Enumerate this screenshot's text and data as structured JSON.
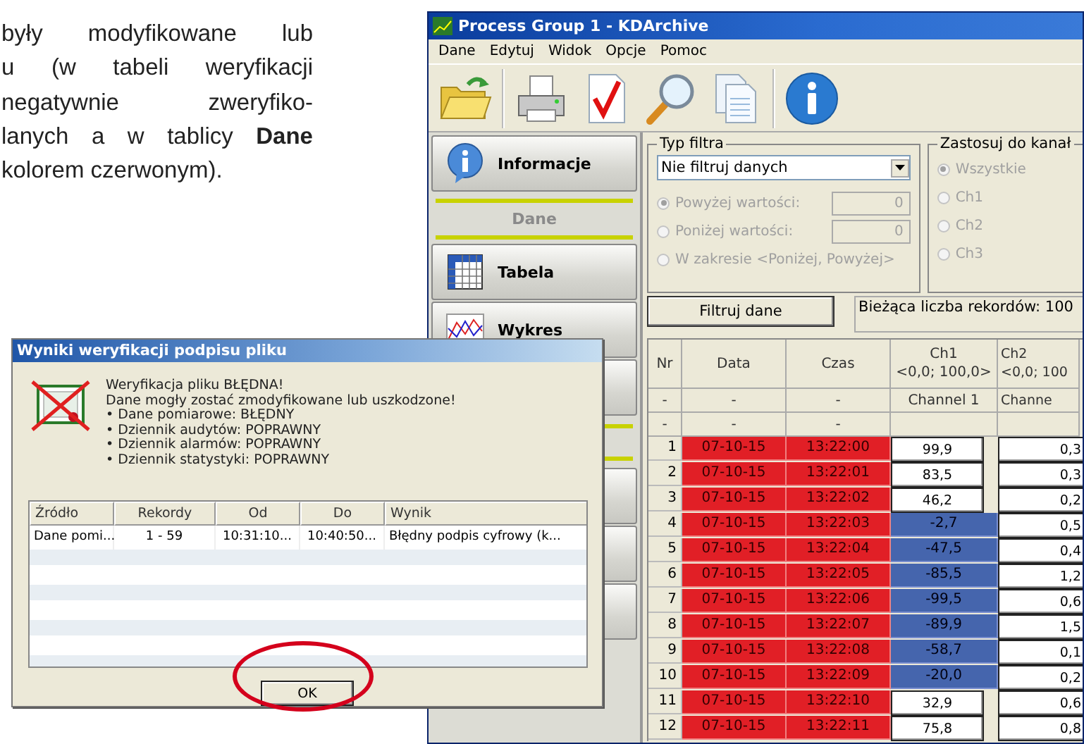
{
  "paragraph": [
    "były modyfikowane lub",
    "u (w tabeli weryfikacji",
    "negatywnie zweryfiko-",
    "lanych a w tablicy **Dane**",
    "kolorem czerwonym)."
  ],
  "window": {
    "title": "Process Group 1 - KDArchive"
  },
  "menu": [
    "Dane",
    "Edytuj",
    "Widok",
    "Opcje",
    "Pomoc"
  ],
  "sidebar": {
    "items": [
      {
        "kind": "info-button",
        "label": "Informacje"
      },
      {
        "kind": "section",
        "label": "Dane"
      },
      {
        "kind": "table-button",
        "label": "Tabela"
      },
      {
        "kind": "chart-button",
        "label": "Wykres"
      },
      {
        "kind": "button"
      },
      {
        "kind": "section"
      },
      {
        "kind": "button"
      },
      {
        "kind": "button"
      },
      {
        "kind": "button"
      }
    ]
  },
  "filter": {
    "legend": "Typ filtra",
    "select_value": "Nie filtruj danych",
    "options": [
      {
        "label": "Powyżej wartości:",
        "selected": true,
        "disabled": true,
        "value": "0"
      },
      {
        "label": "Poniżej wartości:",
        "selected": false,
        "disabled": true,
        "value": "0"
      },
      {
        "label": "W zakresie <Poniżej, Powyżej>",
        "selected": false,
        "disabled": true
      }
    ]
  },
  "channels_group": {
    "legend": "Zastosuj do kanał",
    "options": [
      {
        "label": "Wszystkie",
        "selected": true,
        "disabled": true
      },
      {
        "label": "Ch1",
        "selected": false,
        "disabled": true
      },
      {
        "label": "Ch2",
        "selected": false,
        "disabled": true
      },
      {
        "label": "Ch3",
        "selected": false,
        "disabled": true
      }
    ]
  },
  "filter_button": "Filtruj dane",
  "record_count": "Bieżąca liczba rekordów: 100",
  "table": {
    "columns": [
      [
        "Nr"
      ],
      [
        "Data"
      ],
      [
        "Czas"
      ],
      [
        "Ch1",
        "<0,0; 100,0>"
      ],
      [
        "Ch2",
        "<0,0; 100"
      ]
    ],
    "subheader_rows": [
      [
        "-",
        "-",
        "-",
        "Channel 1",
        "Channe"
      ],
      [
        "-",
        "-",
        "-",
        "",
        ""
      ]
    ],
    "rows": [
      {
        "nr": "1",
        "date": "07-10-15",
        "time": "13:22:00",
        "ch1": "99,9",
        "ch2": "0,3",
        "invalid": true,
        "ch1_low": false
      },
      {
        "nr": "2",
        "date": "07-10-15",
        "time": "13:22:01",
        "ch1": "83,5",
        "ch2": "0,3",
        "invalid": true,
        "ch1_low": false
      },
      {
        "nr": "3",
        "date": "07-10-15",
        "time": "13:22:02",
        "ch1": "46,2",
        "ch2": "0,2",
        "invalid": true,
        "ch1_low": false
      },
      {
        "nr": "4",
        "date": "07-10-15",
        "time": "13:22:03",
        "ch1": "-2,7",
        "ch2": "0,5",
        "invalid": true,
        "ch1_low": true
      },
      {
        "nr": "5",
        "date": "07-10-15",
        "time": "13:22:04",
        "ch1": "-47,5",
        "ch2": "0,4",
        "invalid": true,
        "ch1_low": true
      },
      {
        "nr": "6",
        "date": "07-10-15",
        "time": "13:22:05",
        "ch1": "-85,5",
        "ch2": "1,2",
        "invalid": true,
        "ch1_low": true
      },
      {
        "nr": "7",
        "date": "07-10-15",
        "time": "13:22:06",
        "ch1": "-99,5",
        "ch2": "0,6",
        "invalid": true,
        "ch1_low": true
      },
      {
        "nr": "8",
        "date": "07-10-15",
        "time": "13:22:07",
        "ch1": "-89,9",
        "ch2": "1,5",
        "invalid": true,
        "ch1_low": true
      },
      {
        "nr": "9",
        "date": "07-10-15",
        "time": "13:22:08",
        "ch1": "-58,7",
        "ch2": "0,1",
        "invalid": true,
        "ch1_low": true
      },
      {
        "nr": "10",
        "date": "07-10-15",
        "time": "13:22:09",
        "ch1": "-20,0",
        "ch2": "0,2",
        "invalid": true,
        "ch1_low": true
      },
      {
        "nr": "11",
        "date": "07-10-15",
        "time": "13:22:10",
        "ch1": "32,9",
        "ch2": "0,6",
        "invalid": true,
        "ch1_low": false
      },
      {
        "nr": "12",
        "date": "07-10-15",
        "time": "13:22:11",
        "ch1": "75,8",
        "ch2": "0,8",
        "invalid": true,
        "ch1_low": false
      }
    ]
  },
  "dialog": {
    "title": "Wyniki weryfikacji podpisu pliku",
    "message": [
      "Weryfikacja pliku BŁĘDNA!",
      "Dane mogły zostać zmodyfikowane lub uszkodzone!",
      "• Dane pomiarowe: BŁĘDNY",
      "• Dziennik audytów: POPRAWNY",
      "• Dziennik alarmów: POPRAWNY",
      "• Dziennik statystyki: POPRAWNY"
    ],
    "columns": [
      "Źródło",
      "Rekordy",
      "Od",
      "Do",
      "Wynik"
    ],
    "rows": [
      [
        "Dane pomi...",
        "1 - 59",
        "10:31:10...",
        "10:40:50...",
        "Błędny podpis cyfrowy (k..."
      ]
    ],
    "ok_button": "OK",
    "ok_highlighted": true
  }
}
